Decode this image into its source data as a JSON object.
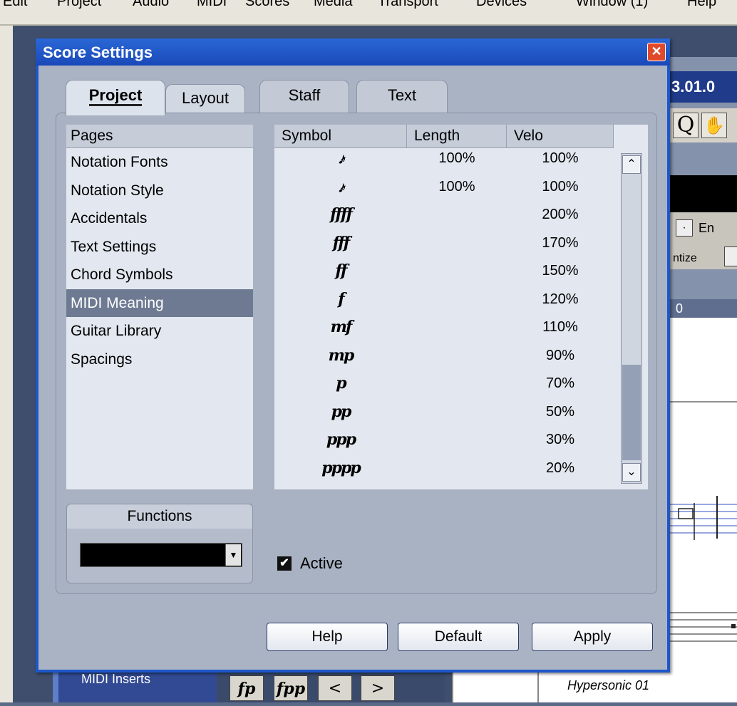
{
  "menubar": [
    "Edit",
    "Project",
    "Audio",
    "MIDI",
    "Scores",
    "Media",
    "Transport",
    "Devices",
    "Window (1)",
    "Help"
  ],
  "background": {
    "title_fragment": "3.01.0",
    "tool_q": "Q",
    "tool_hand": "✋",
    "dot": "·",
    "en_fragment": "En",
    "quantize_fragment": "ntize",
    "ruler_fragment": "0",
    "midi_inserts": "MIDI Inserts",
    "sym_fp": "fp",
    "sym_fpp": "fpp",
    "sym_cresc": "<",
    "sym_decresc": ">",
    "hypersonic": "Hypersonic 01"
  },
  "dialog": {
    "title": "Score Settings",
    "close": "✕",
    "tabs": [
      {
        "label": "Project"
      },
      {
        "label": "Layout"
      },
      {
        "label": "Staff"
      },
      {
        "label": "Text"
      }
    ],
    "pages_header": "Pages",
    "pages": [
      "Notation Fonts",
      "Notation Style",
      "Accidentals",
      "Text Settings",
      "Chord Symbols",
      "MIDI Meaning",
      "Guitar Library",
      "Spacings"
    ],
    "selected_page": "MIDI Meaning",
    "table_headers": {
      "symbol": "Symbol",
      "length": "Length",
      "velo": "Velo"
    },
    "rows": [
      {
        "symbol": "𝆔",
        "length": "100%",
        "velo": "100%"
      },
      {
        "symbol": "𝆔",
        "length": "100%",
        "velo": "100%"
      },
      {
        "symbol": "ffff",
        "length": "",
        "velo": "200%"
      },
      {
        "symbol": "fff",
        "length": "",
        "velo": "170%"
      },
      {
        "symbol": "ff",
        "length": "",
        "velo": "150%"
      },
      {
        "symbol": "f",
        "length": "",
        "velo": "120%"
      },
      {
        "symbol": "mf",
        "length": "",
        "velo": "110%"
      },
      {
        "symbol": "mp",
        "length": "",
        "velo": "90%"
      },
      {
        "symbol": "p",
        "length": "",
        "velo": "70%"
      },
      {
        "symbol": "pp",
        "length": "",
        "velo": "50%"
      },
      {
        "symbol": "ppp",
        "length": "",
        "velo": "30%"
      },
      {
        "symbol": "pppp",
        "length": "",
        "velo": "20%"
      }
    ],
    "scroll_up": "⌃",
    "scroll_down": "⌄",
    "functions_title": "Functions",
    "functions_value": "",
    "combo_arrow": "▼",
    "active_label": "Active",
    "active_checked": "✔",
    "buttons": {
      "help": "Help",
      "default": "Default",
      "apply": "Apply"
    }
  }
}
